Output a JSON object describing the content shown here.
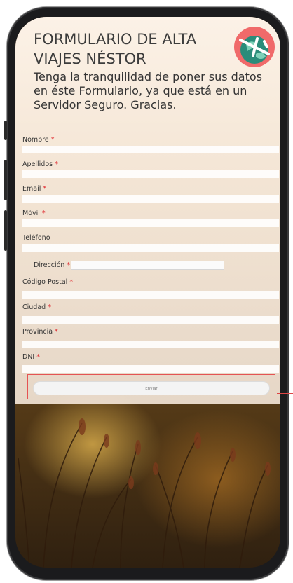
{
  "header": {
    "title_line1": "FORMULARIO DE ALTA",
    "title_line2": "VIAJES NÉSTOR",
    "subtitle": "Tenga la tranquilidad de poner sus datos en éste Formulario, ya que está en un Servidor Seguro. Gracias.",
    "logo_icon": "airplane-globe-logo"
  },
  "form": {
    "required_mark": "*",
    "fields": {
      "nombre": {
        "label": "Nombre",
        "required": true,
        "value": ""
      },
      "apellidos": {
        "label": "Apellidos",
        "required": true,
        "value": ""
      },
      "email": {
        "label": "Email",
        "required": true,
        "value": ""
      },
      "movil": {
        "label": "Móvil",
        "required": true,
        "value": ""
      },
      "telefono": {
        "label": "Teléfono",
        "required": false,
        "value": ""
      },
      "direccion": {
        "label": "Dirección",
        "required": true,
        "value": ""
      },
      "cp": {
        "label": "Código Postal",
        "required": true,
        "value": ""
      },
      "ciudad": {
        "label": "Ciudad",
        "required": true,
        "value": ""
      },
      "provincia": {
        "label": "Provincia",
        "required": true,
        "value": ""
      },
      "dni": {
        "label": "DNI",
        "required": true,
        "value": ""
      }
    },
    "submit_label": "Enviar"
  },
  "colors": {
    "required": "#e0262c",
    "highlight_outline": "#e55353",
    "logo_bg": "#f06a6a",
    "globe": "#2a8c7a"
  }
}
